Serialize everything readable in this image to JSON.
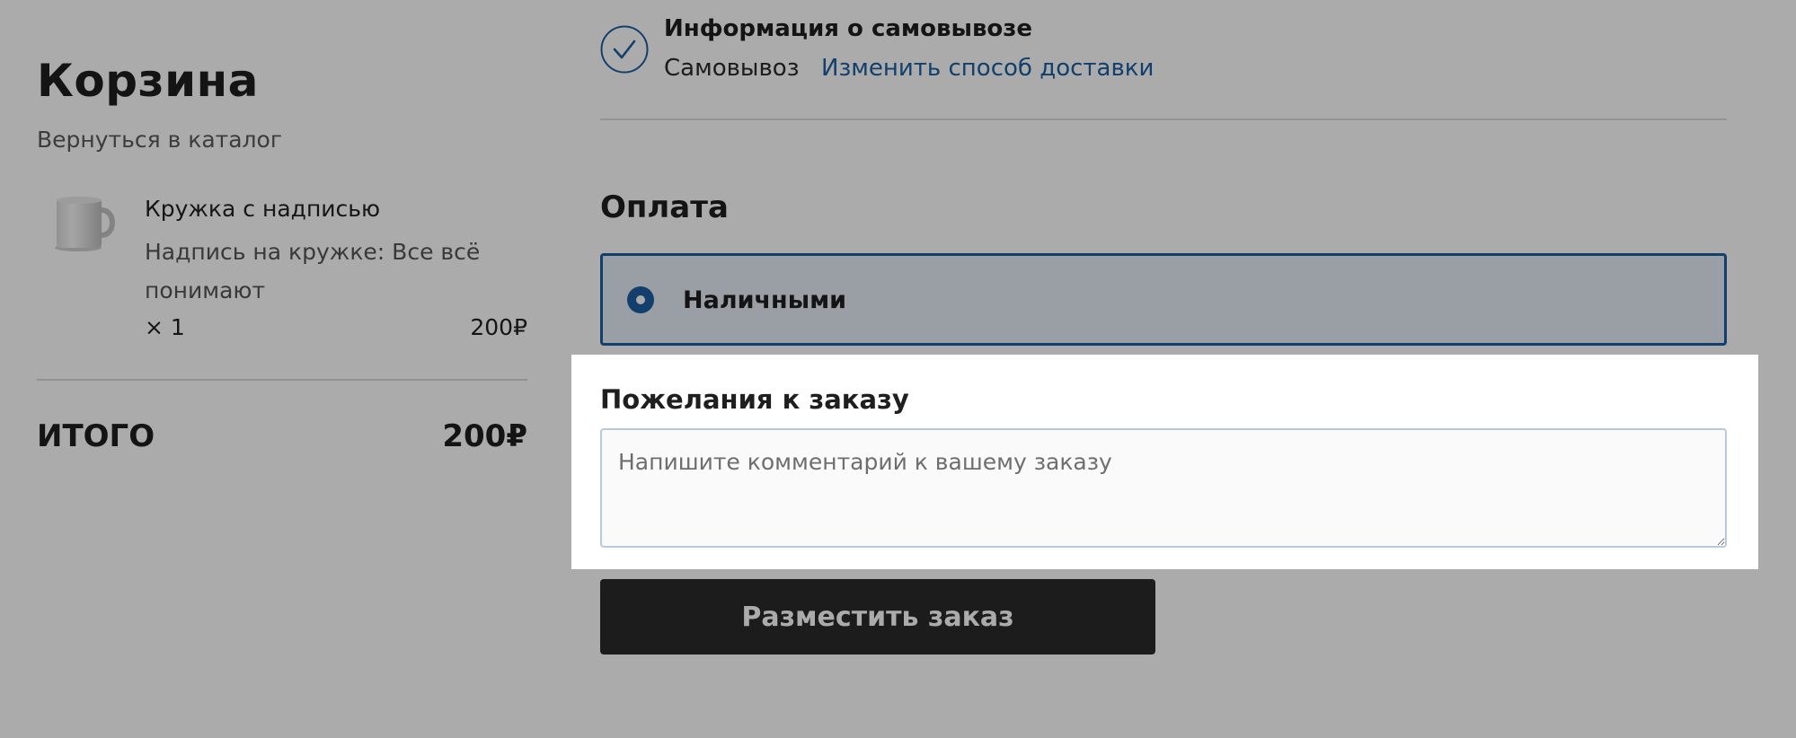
{
  "cart": {
    "title": "Корзина",
    "back_link": "Вернуться в каталог",
    "items": [
      {
        "name": "Кружка с надписью",
        "option": "Надпись на кружке: Все всё понимают",
        "quantity": "× 1",
        "price": "200₽",
        "thumbnail_icon": "mug-image"
      }
    ],
    "total_label": "ИТОГО",
    "total_value": "200₽"
  },
  "delivery": {
    "status_icon": "check-circle-icon",
    "title": "Информация о самовывозе",
    "method": "Самовывоз",
    "change_link": "Изменить способ доставки"
  },
  "payment": {
    "heading": "Оплата",
    "options": [
      {
        "label": "Наличными",
        "selected": true
      }
    ]
  },
  "comment": {
    "heading": "Пожелания к заказу",
    "value": "",
    "placeholder": "Напишите комментарий к вашему заказу"
  },
  "submit": {
    "label": "Разместить заказ"
  },
  "colors": {
    "accent": "#1c5fa1",
    "button_bg": "#2a2a2a",
    "overlay": "rgba(0,0,0,0.33)"
  }
}
